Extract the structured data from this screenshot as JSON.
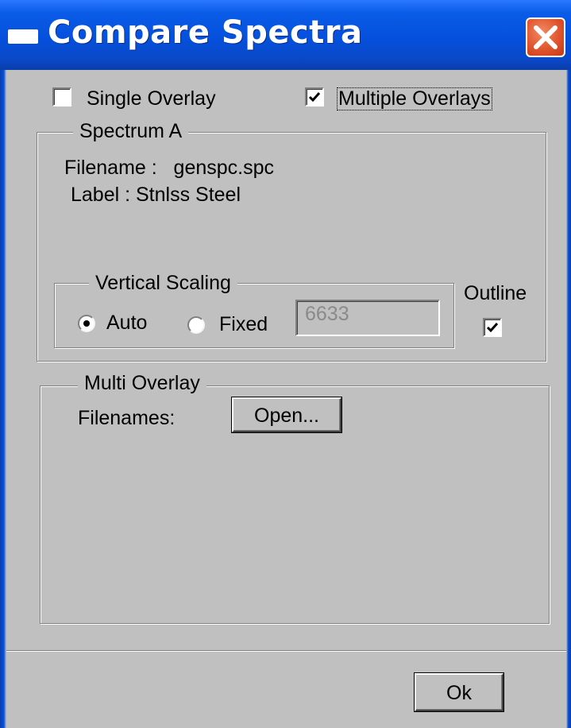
{
  "window": {
    "title": "Compare Spectra"
  },
  "mode": {
    "single_overlay_label": "Single Overlay",
    "single_overlay_checked": false,
    "multiple_overlays_label": "Multiple Overlays",
    "multiple_overlays_checked": true
  },
  "spectrum_a": {
    "group_label": "Spectrum A",
    "filename_line": "Filename :   genspc.spc",
    "label_line": "Label : Stnlss Steel",
    "vertical_scaling": {
      "group_label": "Vertical Scaling",
      "auto_label": "Auto",
      "fixed_label": "Fixed",
      "selected": "Auto",
      "fixed_value": "6633"
    },
    "outline_label": "Outline",
    "outline_checked": true
  },
  "multi_overlay": {
    "group_label": "Multi Overlay",
    "filenames_label": "Filenames:",
    "open_button_label": "Open..."
  },
  "footer": {
    "ok_button_label": "Ok"
  },
  "colors": {
    "titlebar": "#0550dc",
    "dialog_face": "#c0c0c0",
    "close_button": "#e0542e"
  },
  "icons": {
    "window": "window-system-icon",
    "close": "close-x-icon",
    "check": "checkmark-icon"
  }
}
